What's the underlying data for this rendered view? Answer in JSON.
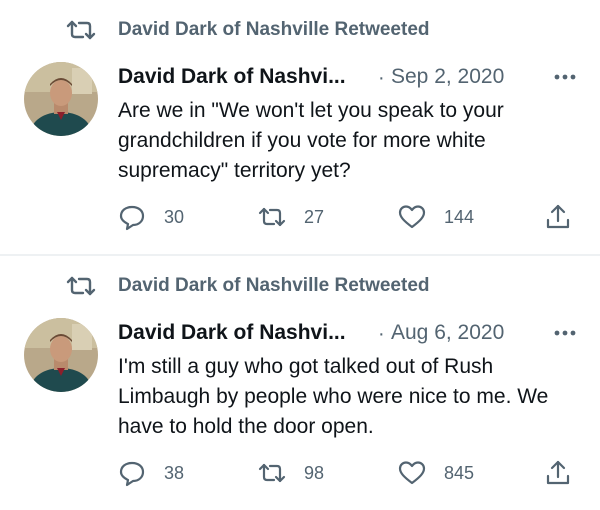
{
  "tweets": [
    {
      "retweeted_by": "David Dark of Nashville Retweeted",
      "author_name": "David Dark of Nashvi...",
      "separator": "·",
      "date": "Sep 2, 2020",
      "text": "Are we in \"We won't let you speak to your grandchildren if you vote for more white supremacy\" territory yet?",
      "replies": "30",
      "retweets": "27",
      "likes": "144"
    },
    {
      "retweeted_by": "David Dark of Nashville Retweeted",
      "author_name": "David Dark of Nashvi...",
      "separator": "·",
      "date": "Aug 6, 2020",
      "text": "I'm still a guy who got talked out of Rush Limbaugh by people who were nice to me. We have to hold the door open.",
      "replies": "38",
      "retweets": "98",
      "likes": "845"
    }
  ],
  "icons": {
    "retweet": "retweet-icon",
    "reply": "reply-icon",
    "like": "heart-icon",
    "share": "share-icon",
    "more": "more-icon"
  },
  "colors": {
    "text_primary": "#0f1419",
    "text_secondary": "#536471",
    "divider": "#e6ecf0"
  }
}
